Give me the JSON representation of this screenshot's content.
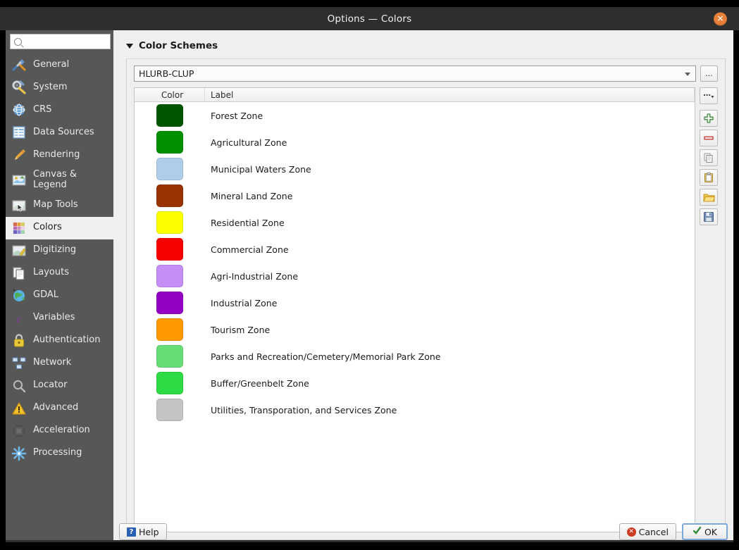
{
  "window": {
    "title": "Options — Colors",
    "close_label": "✕"
  },
  "sidebar": {
    "search_placeholder": "",
    "search_value": "",
    "items": [
      {
        "label": "General",
        "icon": "hammer-screwdriver-icon",
        "selected": false
      },
      {
        "label": "System",
        "icon": "wrench-gear-icon",
        "selected": false
      },
      {
        "label": "CRS",
        "icon": "globe-grid-icon",
        "selected": false
      },
      {
        "label": "Data Sources",
        "icon": "table-icon",
        "selected": false
      },
      {
        "label": "Rendering",
        "icon": "paintbrush-icon",
        "selected": false
      },
      {
        "label": "Canvas & Legend",
        "icon": "map-canvas-icon",
        "selected": false
      },
      {
        "label": "Map Tools",
        "icon": "map-cursor-icon",
        "selected": false
      },
      {
        "label": "Colors",
        "icon": "color-grid-icon",
        "selected": true
      },
      {
        "label": "Digitizing",
        "icon": "map-pencil-icon",
        "selected": false
      },
      {
        "label": "Layouts",
        "icon": "layout-pages-icon",
        "selected": false
      },
      {
        "label": "GDAL",
        "icon": "globe-earth-icon",
        "selected": false
      },
      {
        "label": "Variables",
        "icon": "epsilon-icon",
        "selected": false
      },
      {
        "label": "Authentication",
        "icon": "padlock-icon",
        "selected": false
      },
      {
        "label": "Network",
        "icon": "network-computers-icon",
        "selected": false
      },
      {
        "label": "Locator",
        "icon": "magnifier-icon",
        "selected": false
      },
      {
        "label": "Advanced",
        "icon": "warning-triangle-icon",
        "selected": false
      },
      {
        "label": "Acceleration",
        "icon": "cpu-chip-icon",
        "selected": false
      },
      {
        "label": "Processing",
        "icon": "gear-icon",
        "selected": false
      }
    ]
  },
  "panel": {
    "group_title": "Color Schemes",
    "scheme_selected": "HLURB-CLUP",
    "ellipsis_button": "...",
    "table": {
      "headers": [
        "Color",
        "Label"
      ],
      "rows": [
        {
          "color": "#005500",
          "label": "Forest Zone"
        },
        {
          "color": "#009000",
          "label": "Agricultural Zone"
        },
        {
          "color": "#aecde8",
          "label": "Municipal Waters Zone"
        },
        {
          "color": "#993300",
          "label": "Mineral Land Zone"
        },
        {
          "color": "#fbff00",
          "label": "Residential Zone"
        },
        {
          "color": "#f90000",
          "label": "Commercial Zone"
        },
        {
          "color": "#c48ef5",
          "label": "Agri-Industrial Zone"
        },
        {
          "color": "#9400c4",
          "label": "Industrial Zone"
        },
        {
          "color": "#ff9900",
          "label": "Tourism Zone"
        },
        {
          "color": "#66dd76",
          "label": "Parks and Recreation/Cemetery/Memorial Park Zone"
        },
        {
          "color": "#2ddc45",
          "label": "Buffer/Greenbelt Zone"
        },
        {
          "color": "#c4c4c4",
          "label": "Utilities, Transporation, and Services Zone"
        }
      ]
    },
    "tools": [
      {
        "name": "options-menu",
        "icon": "ellipsis-dropdown-icon"
      },
      {
        "name": "add-color",
        "icon": "green-plus-icon"
      },
      {
        "name": "remove-color",
        "icon": "red-minus-icon"
      },
      {
        "name": "copy-colors",
        "icon": "copy-icon"
      },
      {
        "name": "paste-colors",
        "icon": "paste-clipboard-icon"
      },
      {
        "name": "import-colors",
        "icon": "open-folder-icon"
      },
      {
        "name": "export-colors",
        "icon": "save-floppy-icon"
      }
    ]
  },
  "footer": {
    "help_label": "Help",
    "cancel_label": "Cancel",
    "ok_label": "OK",
    "help_icon_glyph": "?",
    "cancel_icon_glyph": "✕"
  }
}
